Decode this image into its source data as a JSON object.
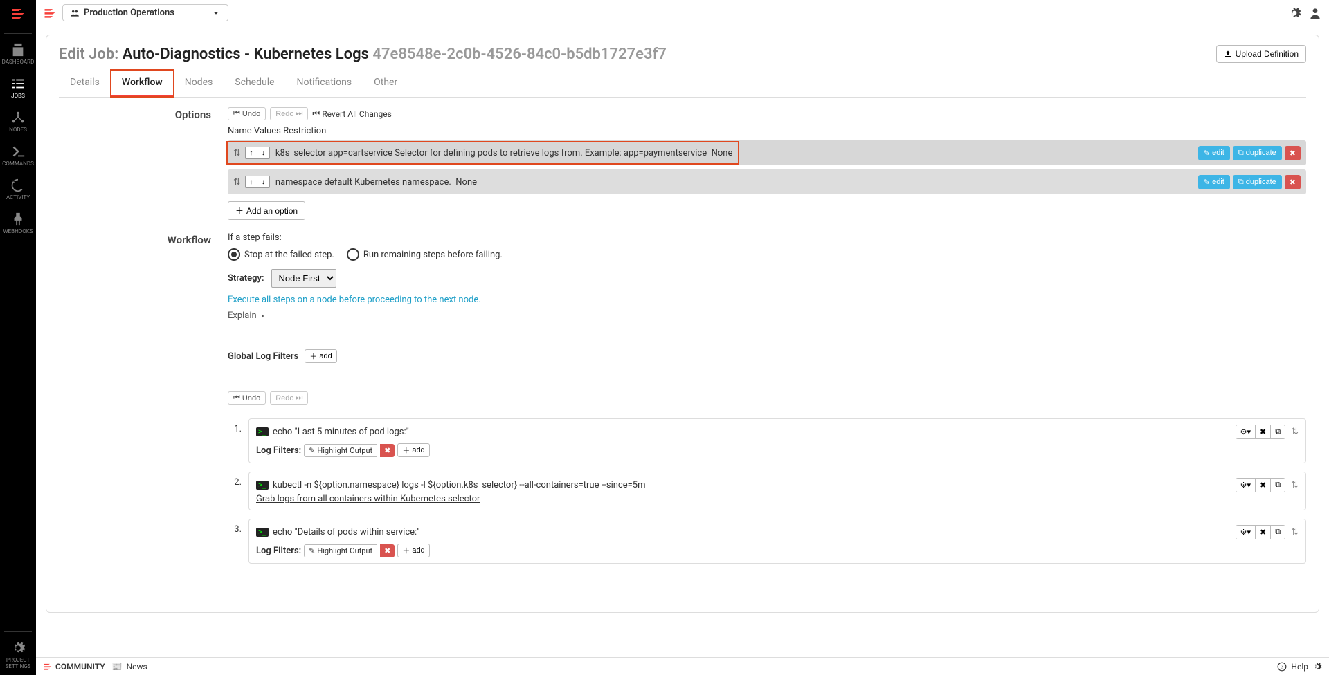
{
  "topbar": {
    "project": "Production Operations"
  },
  "sidebar": {
    "items": [
      {
        "label": "Dashboard"
      },
      {
        "label": "Jobs"
      },
      {
        "label": "Nodes"
      },
      {
        "label": "Commands"
      },
      {
        "label": "Activity"
      },
      {
        "label": "Webhooks"
      }
    ],
    "settings": "Project Settings"
  },
  "header": {
    "prefix": "Edit Job:",
    "name": "Auto-Diagnostics - Kubernetes Logs",
    "uuid": "47e8548e-2c0b-4526-84c0-b5db1727e3f7",
    "upload": "Upload Definition"
  },
  "tabs": {
    "details": "Details",
    "workflow": "Workflow",
    "nodes": "Nodes",
    "schedule": "Schedule",
    "notifications": "Notifications",
    "other": "Other"
  },
  "options": {
    "label": "Options",
    "undo": "Undo",
    "redo": "Redo",
    "revert": "Revert All Changes",
    "subheader": "Name Values Restriction",
    "list": [
      {
        "name": "k8s_selector",
        "value": "app=cartservice",
        "desc": "Selector for defining pods to retrieve logs from. Example: app=paymentservice",
        "restriction": "None"
      },
      {
        "name": "namespace",
        "value": "default",
        "desc": "Kubernetes namespace.",
        "restriction": "None"
      }
    ],
    "edit": "edit",
    "duplicate": "duplicate",
    "add": "Add an option"
  },
  "workflow": {
    "label": "Workflow",
    "fails": "If a step fails:",
    "radio1": "Stop at the failed step.",
    "radio2": "Run remaining steps before failing.",
    "strategy_label": "Strategy:",
    "strategy_value": "Node First",
    "strategy_desc": "Execute all steps on a node before proceeding to the next node.",
    "explain": "Explain",
    "global_log_filters": "Global Log Filters",
    "add": "add"
  },
  "steps": [
    {
      "num": "1.",
      "cmd": "echo \"Last 5 minutes of pod logs:\"",
      "desc": "",
      "has_highlight": true
    },
    {
      "num": "2.",
      "cmd": "kubectl -n ${option.namespace} logs -l ${option.k8s_selector} --all-containers=true --since=5m",
      "desc": "Grab logs from all containers within Kubernetes selector",
      "has_highlight": false
    },
    {
      "num": "3.",
      "cmd": "echo \"Details of pods within service:\"",
      "desc": "",
      "has_highlight": true
    }
  ],
  "step_labels": {
    "log_filters": "Log Filters:",
    "highlight": "Highlight Output",
    "add": "add"
  },
  "footer": {
    "community": "COMMUNITY",
    "news": "News",
    "help": "Help"
  }
}
